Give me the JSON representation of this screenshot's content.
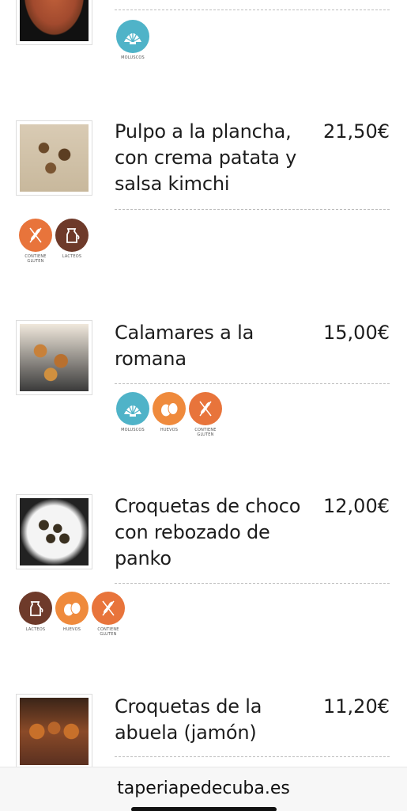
{
  "colors": {
    "mollusc": "#4fb3c8",
    "gluten": "#e8743b",
    "eggs": "#ef8a3c",
    "dairy": "#6e3a2a",
    "divider": "#bdbdbd"
  },
  "allergen_labels": {
    "moluscos": "MOLUSCOS",
    "gluten": "CONTIENE GLUTEN",
    "lacteos": "LACTEOS",
    "huevos": "HUEVOS"
  },
  "items": [
    {
      "name": "",
      "price": "",
      "allergens": [
        "moluscos"
      ]
    },
    {
      "name": "Pulpo a la plancha, con crema patata y salsa kimchi",
      "price": "21,50€",
      "allergens": [
        "gluten",
        "lacteos"
      ]
    },
    {
      "name": "Calamares a la romana",
      "price": "15,00€",
      "allergens": [
        "moluscos",
        "huevos",
        "gluten"
      ]
    },
    {
      "name": "Croquetas de choco con rebozado de panko",
      "price": "12,00€",
      "allergens": [
        "lacteos",
        "huevos",
        "gluten"
      ]
    },
    {
      "name": "Croquetas de la abuela (jamón)",
      "price": "11,20€",
      "allergens": []
    }
  ],
  "browser": {
    "url": "taperiapedecuba.es"
  }
}
